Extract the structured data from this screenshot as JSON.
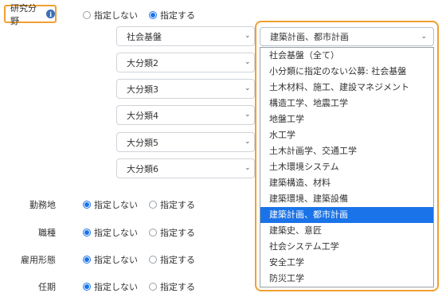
{
  "research_field": {
    "label": "研究分野",
    "info_icon": "i",
    "radio_none": "指定しない",
    "radio_specify": "指定する",
    "selected_option": "specify"
  },
  "category_selects": [
    {
      "value": "社会基盤"
    },
    {
      "value": "大分類2"
    },
    {
      "value": "大分類3"
    },
    {
      "value": "大分類4"
    },
    {
      "value": "大分類5"
    },
    {
      "value": "大分類6"
    }
  ],
  "subcategory_dropdown": {
    "current_value": "建築計画、都市計画",
    "options": [
      "社会基盤（全て）",
      "小分類に指定のない公募: 社会基盤",
      "土木材料、施工、建設マネジメント",
      "構造工学、地震工学",
      "地盤工学",
      "水工学",
      "土木計画学、交通工学",
      "土木環境システム",
      "建築構造、材料",
      "建築環境、建築設備",
      "建築計画、都市計画",
      "建築史、意匠",
      "社会システム工学",
      "安全工学",
      "防災工学"
    ],
    "highlighted_index": 10
  },
  "filters": [
    {
      "label": "勤務地",
      "radio_none": "指定しない",
      "radio_specify": "指定する",
      "selected_option": "none"
    },
    {
      "label": "職種",
      "radio_none": "指定しない",
      "radio_specify": "指定する",
      "selected_option": "none"
    },
    {
      "label": "雇用形態",
      "radio_none": "指定しない",
      "radio_specify": "指定する",
      "selected_option": "none"
    },
    {
      "label": "任期",
      "radio_none": "指定しない",
      "radio_specify": "指定する",
      "selected_option": "none"
    }
  ],
  "colors": {
    "accent_orange": "#f0a030",
    "radio_blue": "#1a73e8",
    "highlight_blue": "#1a73e8"
  }
}
